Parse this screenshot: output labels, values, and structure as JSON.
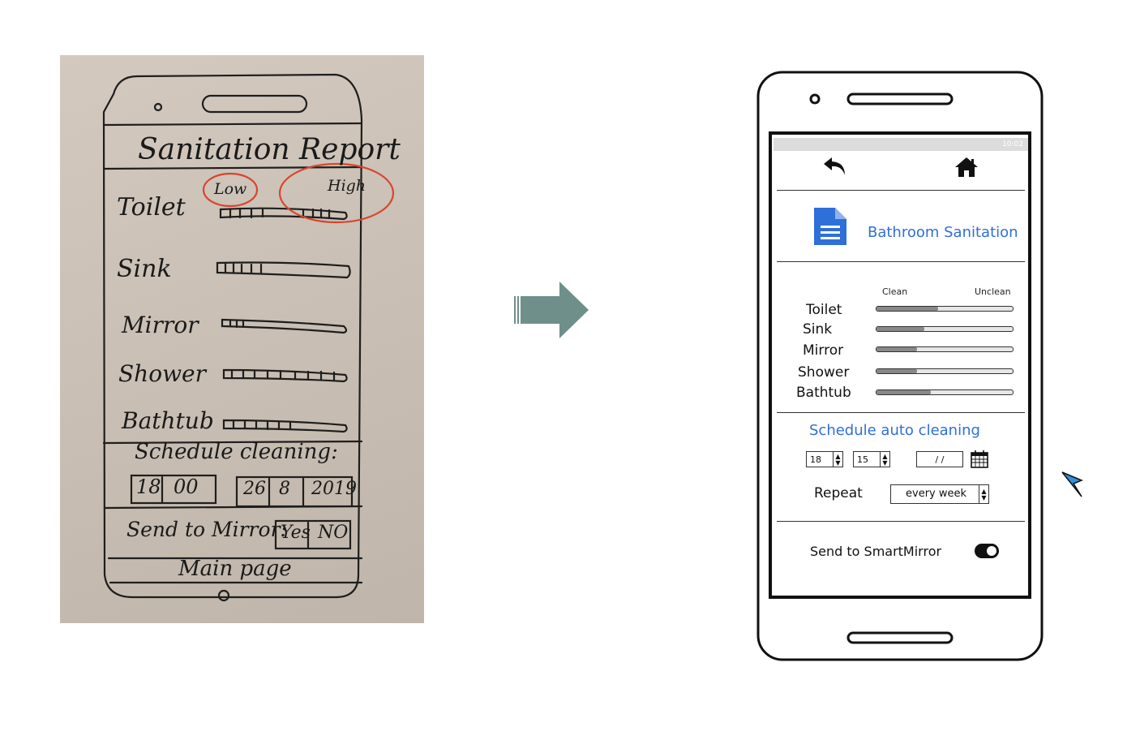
{
  "sketch": {
    "title": "Sanitation Report",
    "scale_low": "Low",
    "scale_high": "High",
    "items": [
      "Toilet",
      "Sink",
      "Mirror",
      "Shower",
      "Bathtub"
    ],
    "schedule_label": "Schedule cleaning:",
    "time_hour": "18",
    "time_minute": "00",
    "date_day": "26",
    "date_month": "8",
    "date_year": "2019",
    "send_label": "Send to Mirror:",
    "yes_label": "Yes",
    "no_label": "NO",
    "main_page_label": "Main page"
  },
  "mockup": {
    "status_time": "10:02",
    "title": "Bathroom Sanitation",
    "scale_clean": "Clean",
    "scale_unclean": "Unclean",
    "items": [
      {
        "label": "Toilet",
        "level": 0.45
      },
      {
        "label": "Sink",
        "level": 0.35
      },
      {
        "label": "Mirror",
        "level": 0.3
      },
      {
        "label": "Shower",
        "level": 0.3
      },
      {
        "label": "Bathtub",
        "level": 0.4
      }
    ],
    "schedule_title": "Schedule auto cleaning",
    "hour": "18",
    "minute": "15",
    "date_placeholder": "/ /",
    "repeat_label": "Repeat",
    "repeat_value": "every week",
    "send_label": "Send to SmartMirror",
    "send_enabled": true
  },
  "colors": {
    "accent": "#2f6fd8",
    "arrow": "#6f8f8b",
    "sketch_circle": "#d9452e",
    "photo_bg": "#c9bfb4"
  },
  "icons": [
    "back-icon",
    "home-icon",
    "document-icon",
    "calendar-icon",
    "arrow-right-icon",
    "cursor-icon"
  ]
}
